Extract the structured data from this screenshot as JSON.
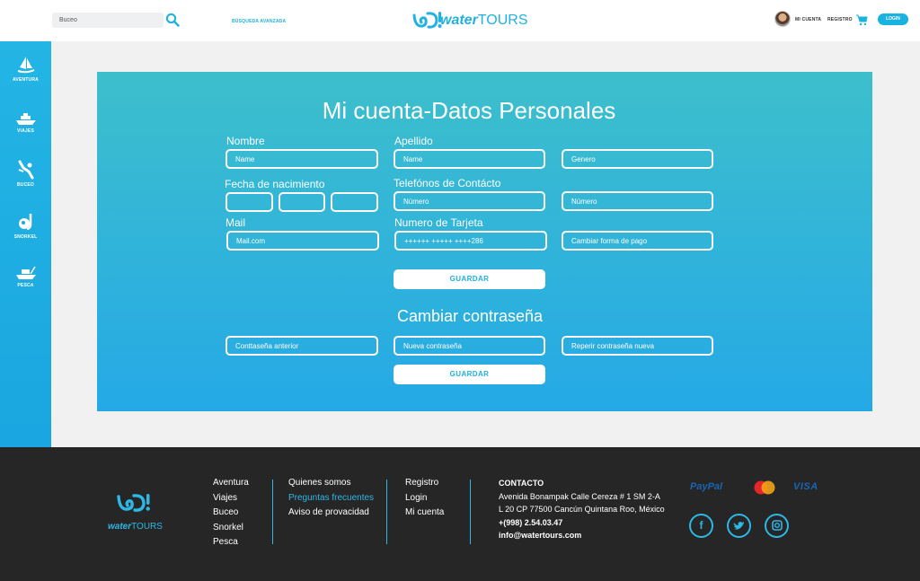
{
  "header": {
    "search_value": "Buceo",
    "advanced_search": "BÚSQUEDA AVANZADA",
    "logo_text_a": "water",
    "logo_text_b": "TOURS",
    "my_account": "MI CUENTA",
    "register": "REGISTRO",
    "login": "LOGIN"
  },
  "sidebar": {
    "items": [
      {
        "label": "AVENTURA",
        "icon": "windsurf-icon"
      },
      {
        "label": "VIAJES",
        "icon": "boat-icon"
      },
      {
        "label": "BUCEO",
        "icon": "diver-icon"
      },
      {
        "label": "SNORKEL",
        "icon": "snorkel-icon"
      },
      {
        "label": "PESCA",
        "icon": "fishing-boat-icon"
      }
    ]
  },
  "form": {
    "title": "Mi cuenta-Datos Personales",
    "labels": {
      "first_name": "Nombre",
      "last_name": "Apellido",
      "birth_date": "Fecha de nacimiento",
      "phones": "Telefónos de Contácto",
      "mail": "Mail",
      "card_number": "Numero de Tarjeta"
    },
    "placeholders": {
      "first_name": "Name",
      "last_name": "Name",
      "gender": "Genero",
      "phone1": "Número",
      "phone2": "Número",
      "mail": "Mail.com",
      "change_payment": "Cambiar forma de pago"
    },
    "values": {
      "card_number": "++++++ +++++ ++++286"
    },
    "save_label": "GUARDAR",
    "password": {
      "title": "Cambiar contraseña",
      "old_placeholder": "Conttaseña anterior",
      "new_placeholder": "Nueva contraseña",
      "repeat_placeholder": "Reperir contraseña nueva",
      "save_label": "GUARDAR"
    }
  },
  "footer": {
    "col1": [
      "Aventura",
      "Viajes",
      "Buceo",
      "Snorkel",
      "Pesca"
    ],
    "col2": [
      "Quienes somos",
      "Preguntas frecuentes",
      "Aviso de provacidad"
    ],
    "col3": [
      "Registro",
      "Login",
      "Mi cuenta"
    ],
    "contact": {
      "heading": "CONTACTO",
      "line1": "Avenida Bonampak Calle Cereza # 1 SM 2-A",
      "line2": "L 20 CP 77500 Cancún Quintana Roo, México",
      "phone": "+(998) 2.54.03.47",
      "email": "info@watertours.com"
    },
    "payments": [
      "PayPal",
      "MasterCard",
      "VISA"
    ],
    "social": [
      "facebook-icon",
      "twitter-icon",
      "instagram-icon"
    ],
    "logo_a": "water",
    "logo_b": "TOURS"
  },
  "colors": {
    "accent": "#1ab2e0",
    "footer_bg": "#262626"
  }
}
